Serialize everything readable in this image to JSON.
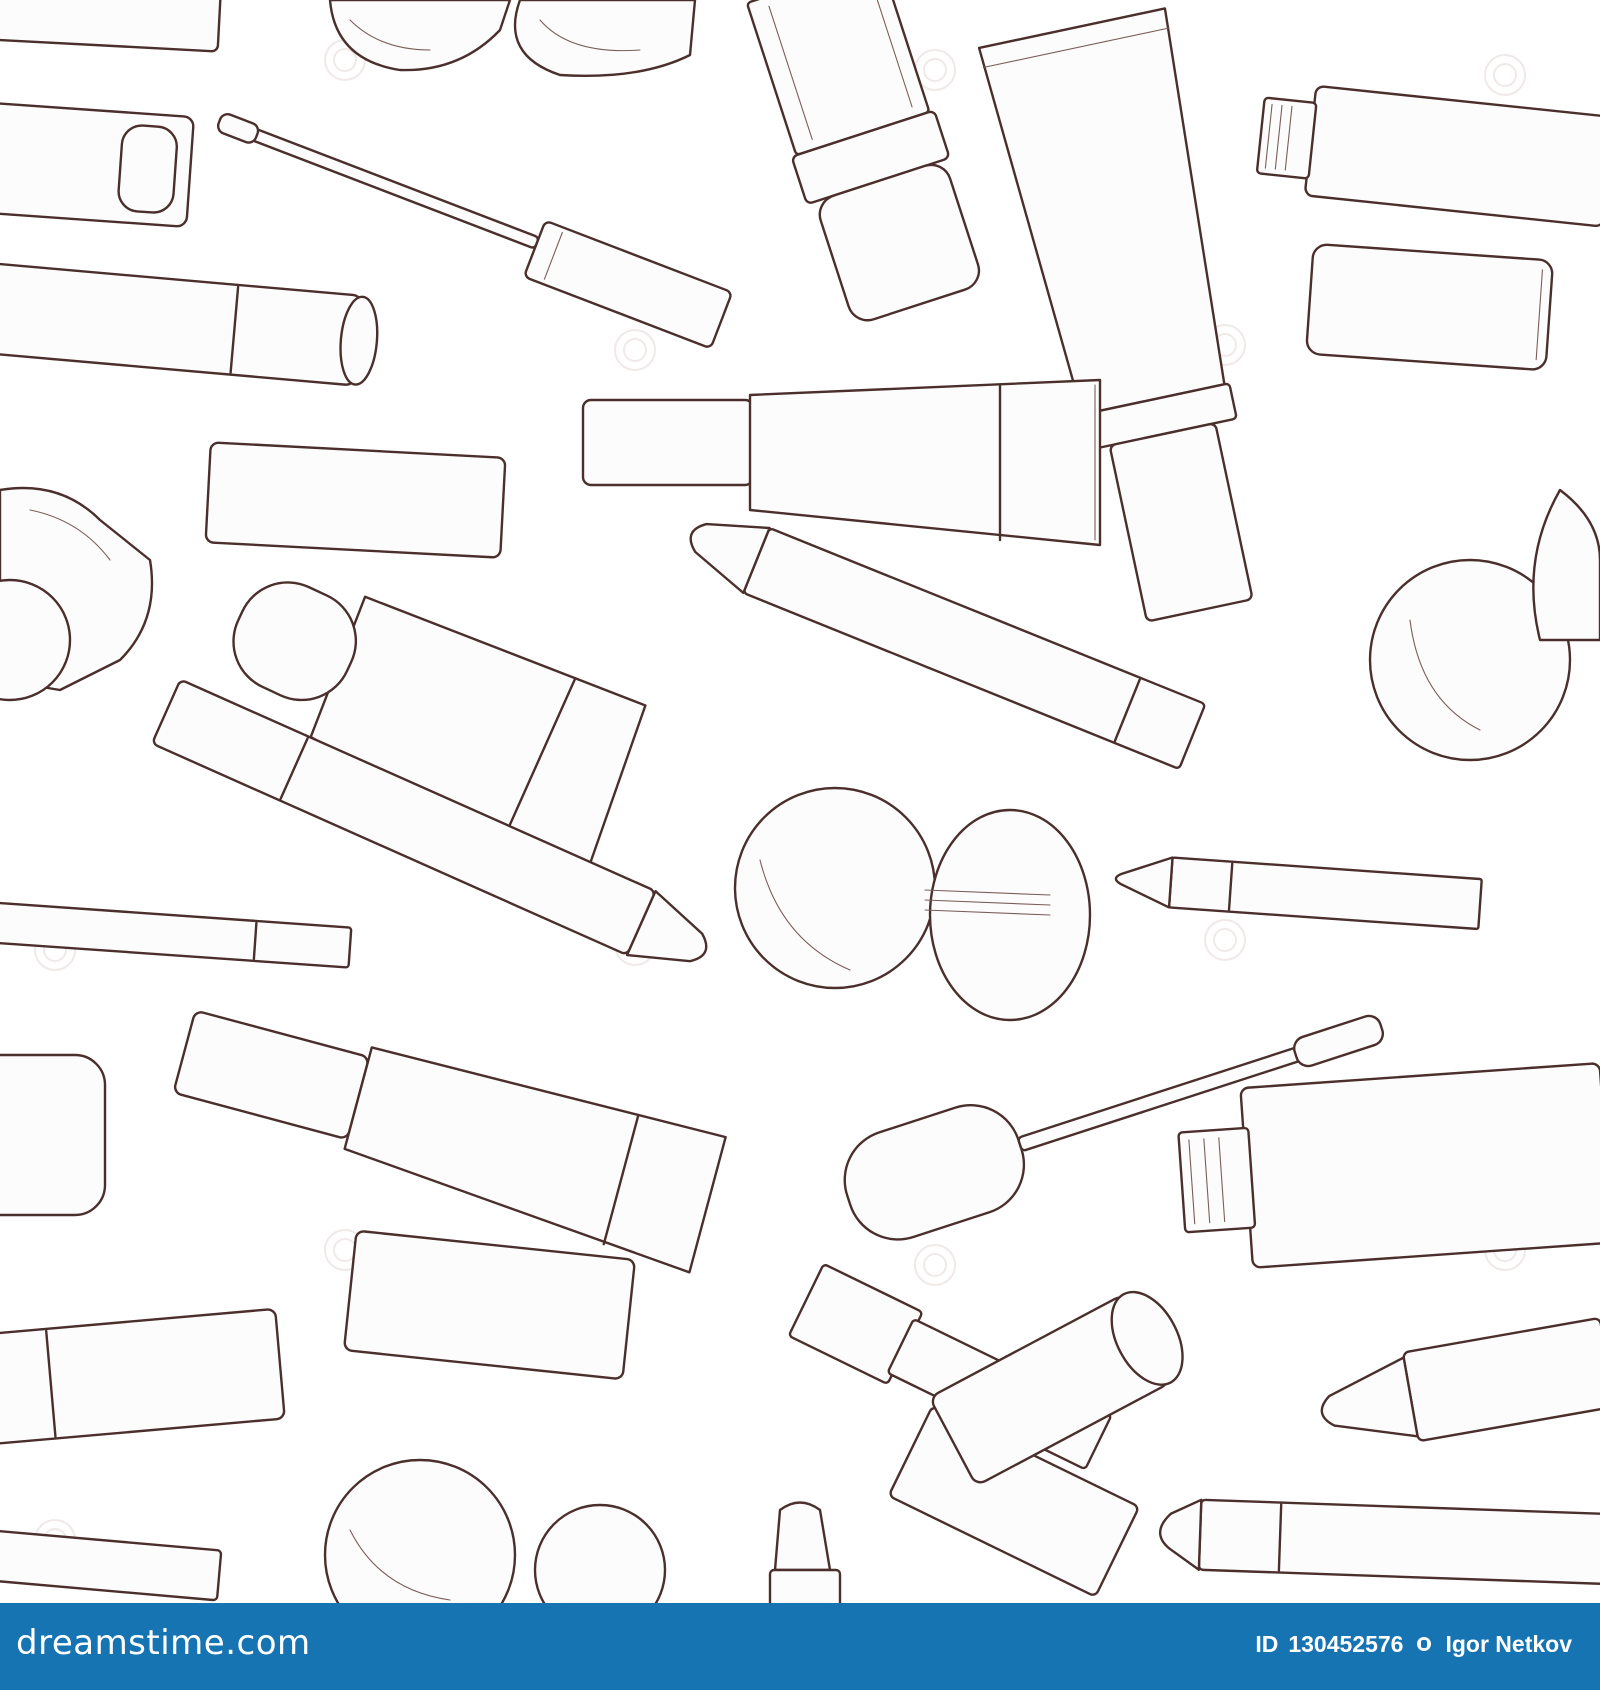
{
  "image": {
    "subject": "seamless hand-drawn pattern of lip makeup cosmetics",
    "colors": {
      "background": "#ffffff",
      "line": "#4a2f2c",
      "banner": "#1774b3",
      "banner_text": "#ffffff"
    }
  },
  "footer": {
    "logo_text": "dreamstime.com",
    "id_label": "ID",
    "id_value": "130452576",
    "author": "Igor Netkov",
    "separator_icon": "author-icon"
  }
}
